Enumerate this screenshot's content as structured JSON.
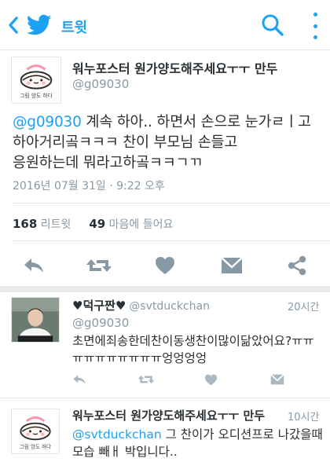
{
  "header": {
    "back_icon": "chevron-left-icon",
    "logo_icon": "twitter-bird-icon",
    "title": "트윗",
    "search_icon": "search-icon",
    "more_icon": "vertical-dots-icon",
    "accent_color": "#1da1f2"
  },
  "main_tweet": {
    "avatar_text": "그림 양도 하다",
    "display_name": "워누포스터 원가양도해주세요ㅜㅜ 만두",
    "handle": "@g09030",
    "mention": "@g09030",
    "body_line1": " 계속 하아.. 하면서 손으로 눈가ㄹㅣ고",
    "body_line2": "하아거리곸ㅋㅋㅋ 찬이 부모님 손들고",
    "body_line3": "응원하는데 뭐라고하곸ㅋㅋㄱㄲ",
    "timestamp": "2016년 07월 31일 · 9:22 오후",
    "retweet_count": "168",
    "retweet_label": "리트윗",
    "like_count": "49",
    "like_label": "마음에 들어요"
  },
  "replies": [
    {
      "display_name": "♥덕구짠♥",
      "handle": "@svtduckchan",
      "time": "20시간",
      "reply_to": "@g09030",
      "line1": "초면에죄송한데찬이동생찬이많이닮았어요?ㅠㅠ",
      "line2": "ㅠㅠㅠㅠㅠㅠㅠㅠ엉엉엉엉"
    },
    {
      "avatar_text": "그림 양도 하다",
      "display_name": "워누포스터 원가양도해주세요ㅜㅜ 만두",
      "time": "10시간",
      "mention": "@svtduckchan",
      "line1_rest": " 그 찬이가 오디션프로 나갔을때",
      "line2": "모습 빼ㅐ 박입니다.."
    }
  ]
}
